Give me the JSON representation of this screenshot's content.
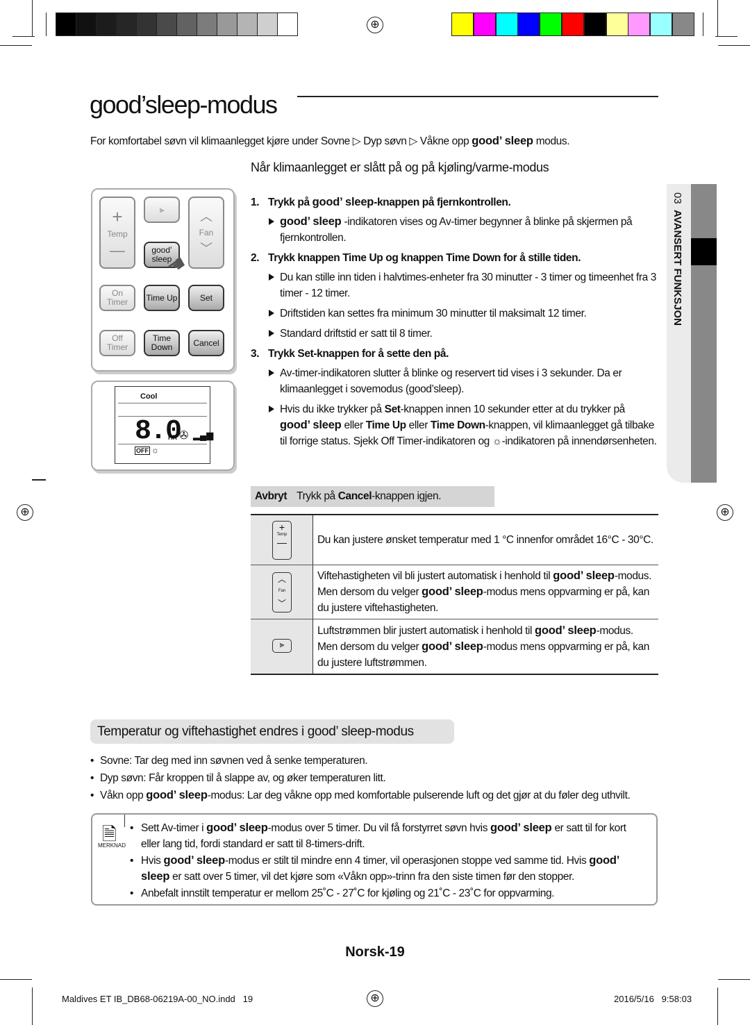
{
  "title": "good’sleep-modus",
  "intro": [
    {
      "t": "For komfortabel søvn vil klimaanlegget kjøre under Sovne ▷ Dyp søvn ▷ Våkne opp "
    },
    {
      "t": "good’ sleep",
      "s": "g"
    },
    {
      "t": " modus."
    }
  ],
  "subheading": "Når klimaanlegget er slått på og på kjøling/varme-modus",
  "remote": {
    "temp": "Temp",
    "fan": "Fan",
    "good_sleep": "good’ sleep",
    "on_timer": "On Timer",
    "time_up": "Time Up",
    "set": "Set",
    "off_timer": "Off Timer",
    "time_down": "Time Down",
    "cancel": "Cancel"
  },
  "display": {
    "mode": "Cool",
    "value": "8.0",
    "unit": "HR",
    "off": "OFF"
  },
  "steps": [
    {
      "num": "1.",
      "head": [
        {
          "t": "Trykk på "
        },
        {
          "t": "good’ sleep",
          "s": "g"
        },
        {
          "t": "-knappen på fjernkontrollen."
        }
      ],
      "items": [
        [
          {
            "t": "good’ sleep",
            "s": "g"
          },
          {
            "t": " -indikatoren vises og Av-timer begynner å blinke på skjermen på fjernkontrollen."
          }
        ]
      ]
    },
    {
      "num": "2.",
      "head": [
        {
          "t": "Trykk knappen "
        },
        {
          "t": "Time Up",
          "s": "b"
        },
        {
          "t": " og knappen "
        },
        {
          "t": "Time Down",
          "s": "b"
        },
        {
          "t": " for å stille tiden."
        }
      ],
      "items": [
        [
          {
            "t": "Du kan stille inn tiden i halvtimes-enheter fra 30 minutter - 3 timer og timeenhet fra 3 timer - 12 timer."
          }
        ],
        [
          {
            "t": "Driftstiden kan settes fra minimum 30 minutter til maksimalt 12 timer."
          }
        ],
        [
          {
            "t": "Standard driftstid er satt til 8 timer."
          }
        ]
      ]
    },
    {
      "num": "3.",
      "head": [
        {
          "t": "Trykk "
        },
        {
          "t": "Set",
          "s": "b"
        },
        {
          "t": "-knappen for å sette den på."
        }
      ],
      "items": [
        [
          {
            "t": "Av-timer-indikatoren slutter å blinke og reservert tid vises i 3 sekunder. Da er klimaanlegget i sovemodus (good’sleep)."
          }
        ],
        [
          {
            "t": "Hvis du ikke trykker på "
          },
          {
            "t": "Set",
            "s": "b"
          },
          {
            "t": "-knappen innen 10 sekunder etter at du trykker på "
          },
          {
            "t": "good’ sleep",
            "s": "g"
          },
          {
            "t": " eller "
          },
          {
            "t": "Time Up",
            "s": "b"
          },
          {
            "t": " eller "
          },
          {
            "t": "Time Down",
            "s": "b"
          },
          {
            "t": "-knappen, vil klimaanlegget gå tilbake til forrige status. Sjekk Off Timer-indikatoren og ☼-indikatoren på innendørsenheten."
          }
        ]
      ]
    }
  ],
  "cancel_bar": {
    "label": "Avbryt",
    "text": [
      {
        "t": "Trykk på "
      },
      {
        "t": "Cancel",
        "s": "b"
      },
      {
        "t": "-knappen igjen."
      }
    ]
  },
  "table": [
    {
      "icon": "temp-button-icon",
      "icon_label": "Temp",
      "text": [
        {
          "t": "Du kan justere ønsket temperatur med 1 °C innenfor området 16°C - 30°C."
        }
      ]
    },
    {
      "icon": "fan-button-icon",
      "icon_label": "Fan",
      "text": [
        {
          "t": "Viftehastigheten vil bli justert automatisk i henhold til "
        },
        {
          "t": "good’ sleep",
          "s": "g"
        },
        {
          "t": "-modus. Men dersom du velger "
        },
        {
          "t": "good’ sleep",
          "s": "g"
        },
        {
          "t": "-modus mens oppvarming er på, kan du justere viftehastigheten."
        }
      ]
    },
    {
      "icon": "airflow-button-icon",
      "icon_label": "",
      "text": [
        {
          "t": "Luftstrømmen blir justert automatisk i henhold til "
        },
        {
          "t": "good’ sleep",
          "s": "g"
        },
        {
          "t": "-modus. Men dersom du velger "
        },
        {
          "t": "good’ sleep",
          "s": "g"
        },
        {
          "t": "-modus mens oppvarming er på, kan du justere luftstrømmen."
        }
      ]
    }
  ],
  "section2": {
    "heading": "Temperatur og viftehastighet endres i good’ sleep-modus",
    "bullets": [
      [
        {
          "t": "Sovne: Tar deg med inn søvnen ved å senke temperaturen."
        }
      ],
      [
        {
          "t": "Dyp søvn: Får kroppen til å slappe av, og øker temperaturen litt."
        }
      ],
      [
        {
          "t": "Våkn opp "
        },
        {
          "t": "good’ sleep",
          "s": "g"
        },
        {
          "t": "-modus: Lar deg våkne opp med komfortable pulserende luft og det gjør at du føler deg uthvilt."
        }
      ]
    ]
  },
  "note": {
    "label": "MERKNAD",
    "bullets": [
      [
        {
          "t": "Sett Av-timer i "
        },
        {
          "t": "good’ sleep",
          "s": "g"
        },
        {
          "t": "-modus over 5 timer. Du vil få forstyrret søvn hvis "
        },
        {
          "t": "good’ sleep",
          "s": "g"
        },
        {
          "t": " er satt til for kort eller lang tid, fordi standard er satt til 8-timers-drift."
        }
      ],
      [
        {
          "t": "Hvis "
        },
        {
          "t": "good’ sleep",
          "s": "g"
        },
        {
          "t": "-modus er stilt til mindre enn 4 timer, vil operasjonen stoppe ved samme tid. Hvis "
        },
        {
          "t": "good’ sleep",
          "s": "g"
        },
        {
          "t": " er satt over 5 timer, vil det kjøre som «Våkn opp»-trinn fra den siste timen før den stopper."
        }
      ],
      [
        {
          "t": "Anbefalt innstilt temperatur er mellom 25˚C - 27˚C for kjøling og 21˚C - 23˚C for oppvarming."
        }
      ]
    ]
  },
  "side_tab": {
    "number": "03",
    "label": "AVANSERT FUNKSJON"
  },
  "page_number": "Norsk-19",
  "footer": {
    "file": "Maldives ET IB_DB68-06219A-00_NO.indd   19",
    "date": "2016/5/16   9:58:03"
  },
  "colors": {
    "grays": [
      "#000000",
      "#111111",
      "#1c1c1c",
      "#262626",
      "#333333",
      "#4a4a4a",
      "#626262",
      "#7c7c7c",
      "#999999",
      "#b4b4b4",
      "#cfcfcf",
      "#ffffff"
    ],
    "swatches": [
      "#ffff00",
      "#ff00ff",
      "#00ffff",
      "#0000ff",
      "#00ff00",
      "#ff0000",
      "#000000",
      "#ffff99",
      "#ff99ff",
      "#99ffff",
      "#888888"
    ]
  }
}
